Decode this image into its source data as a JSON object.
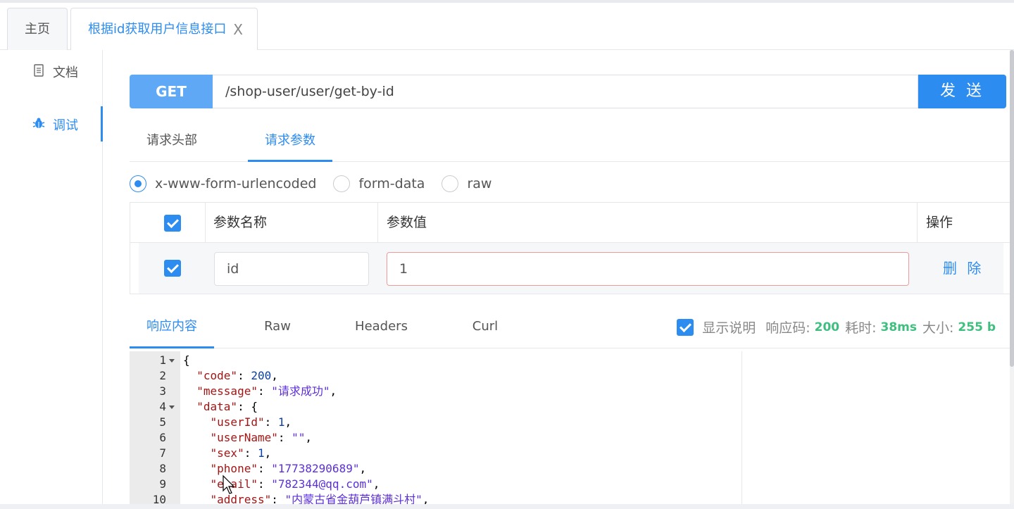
{
  "tabs": [
    {
      "label": "主页"
    },
    {
      "label": "根据id获取用户信息接口",
      "close": "X"
    }
  ],
  "sidebar": {
    "items": [
      {
        "label": "文档",
        "icon": "document-icon"
      },
      {
        "label": "调试",
        "icon": "bug-icon"
      }
    ]
  },
  "request": {
    "method": "GET",
    "url": "/shop-user/user/get-by-id",
    "send_label": "发 送"
  },
  "request_tabs": [
    {
      "label": "请求头部"
    },
    {
      "label": "请求参数"
    }
  ],
  "body_types": [
    {
      "label": "x-www-form-urlencoded",
      "selected": true
    },
    {
      "label": "form-data",
      "selected": false
    },
    {
      "label": "raw",
      "selected": false
    }
  ],
  "params": {
    "headers": {
      "name": "参数名称",
      "value": "参数值",
      "action": "操作"
    },
    "rows": [
      {
        "checked": true,
        "name": "id",
        "value": "1",
        "delete_label": "删 除"
      }
    ]
  },
  "response_tabs": [
    {
      "label": "响应内容"
    },
    {
      "label": "Raw"
    },
    {
      "label": "Headers"
    },
    {
      "label": "Curl"
    }
  ],
  "response_meta": {
    "show_desc_label": "显示说明",
    "status_label": "响应码:",
    "status": "200",
    "time_label": "耗时:",
    "time": "38ms",
    "size_label": "大小:",
    "size": "255 b"
  },
  "code_lines": [
    {
      "no": "1",
      "text": "{"
    },
    {
      "no": "2",
      "key": "\"code\"",
      "sep": ": ",
      "num": "200",
      "tail": ","
    },
    {
      "no": "3",
      "key": "\"message\"",
      "sep": ": ",
      "str": "\"请求成功\"",
      "tail": ","
    },
    {
      "no": "4",
      "key": "\"data\"",
      "sep": ": ",
      "tail": "{"
    },
    {
      "no": "5",
      "key": "\"userId\"",
      "sep": ": ",
      "num": "1",
      "tail": ","
    },
    {
      "no": "6",
      "key": "\"userName\"",
      "sep": ": ",
      "str": "\"\"",
      "tail": ","
    },
    {
      "no": "7",
      "key": "\"sex\"",
      "sep": ": ",
      "num": "1",
      "tail": ","
    },
    {
      "no": "8",
      "key": "\"phone\"",
      "sep": ": ",
      "str": "\"17738290689\"",
      "tail": ","
    },
    {
      "no": "9",
      "key": "\"email\"",
      "sep": ": ",
      "str": "\"782344@qq.com\"",
      "tail": ","
    },
    {
      "no": "10",
      "key": "\"address\"",
      "sep": ": ",
      "str": "\"内蒙古省金葫芦镇满斗村\"",
      "tail": ","
    }
  ],
  "colors": {
    "accent": "#2d8cf0",
    "method_bg": "#5ea8f6",
    "success": "#3fbf7f"
  }
}
